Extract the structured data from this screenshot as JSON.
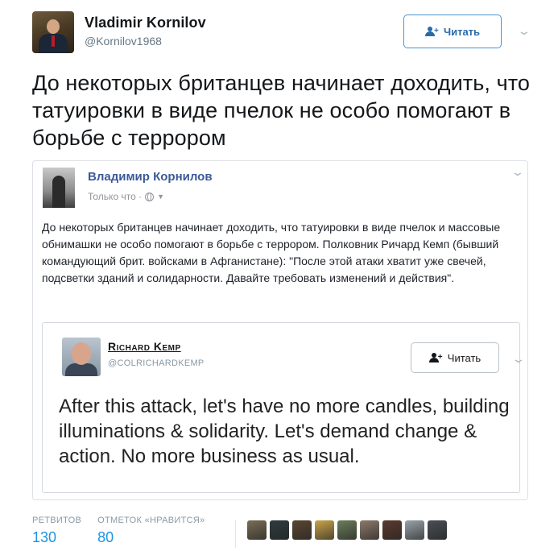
{
  "tweet": {
    "author_name": "Vladimir Kornilov",
    "author_handle": "@Kornilov1968",
    "follow_label": "Читать",
    "text": "До некоторых британцев начинает доходить, что татуировки в виде пчелок не особо помогают в борьбе с террором"
  },
  "fb_post": {
    "author_name": "Владимир Корнилов",
    "time_label": "Только что ·",
    "text": "До некоторых британцев начинает доходить, что татуировки в виде пчелок и массовые обнимашки не особо помогают в борьбе с террором. Полковник Ричард Кемп (бывший командующий брит. войсками в Афганистане): \"После этой атаки хватит уже свечей, подсветки зданий и солидарности. Давайте требовать изменений и действия\"."
  },
  "quoted_tweet": {
    "author_name": "Richard Kemp",
    "author_handle": "@COLRICHARDKEMP",
    "follow_label": "Читать",
    "text": "After this attack, let's have no more candles, building illuminations & solidarity. Let's demand change & action. No more business as usual."
  },
  "stats": {
    "retweets_label": "РЕТВИТОВ",
    "retweets_value": "130",
    "likes_label": "ОТМЕТОК «НРАВИТСЯ»",
    "likes_value": "80"
  },
  "liker_avatars": [
    {
      "color": "#7a6d55"
    },
    {
      "color": "#2f3b3f"
    },
    {
      "color": "#5a4632"
    },
    {
      "color": "#c9a44a"
    },
    {
      "color": "#6b7d5a"
    },
    {
      "color": "#8c7a6a"
    },
    {
      "color": "#5b3a2e"
    },
    {
      "color": "#9aa3ab"
    },
    {
      "color": "#4a4f55"
    }
  ],
  "colors": {
    "link_blue": "#1b95e0",
    "fb_blue": "#3b5998",
    "follow_blue": "#2a6aa8"
  }
}
